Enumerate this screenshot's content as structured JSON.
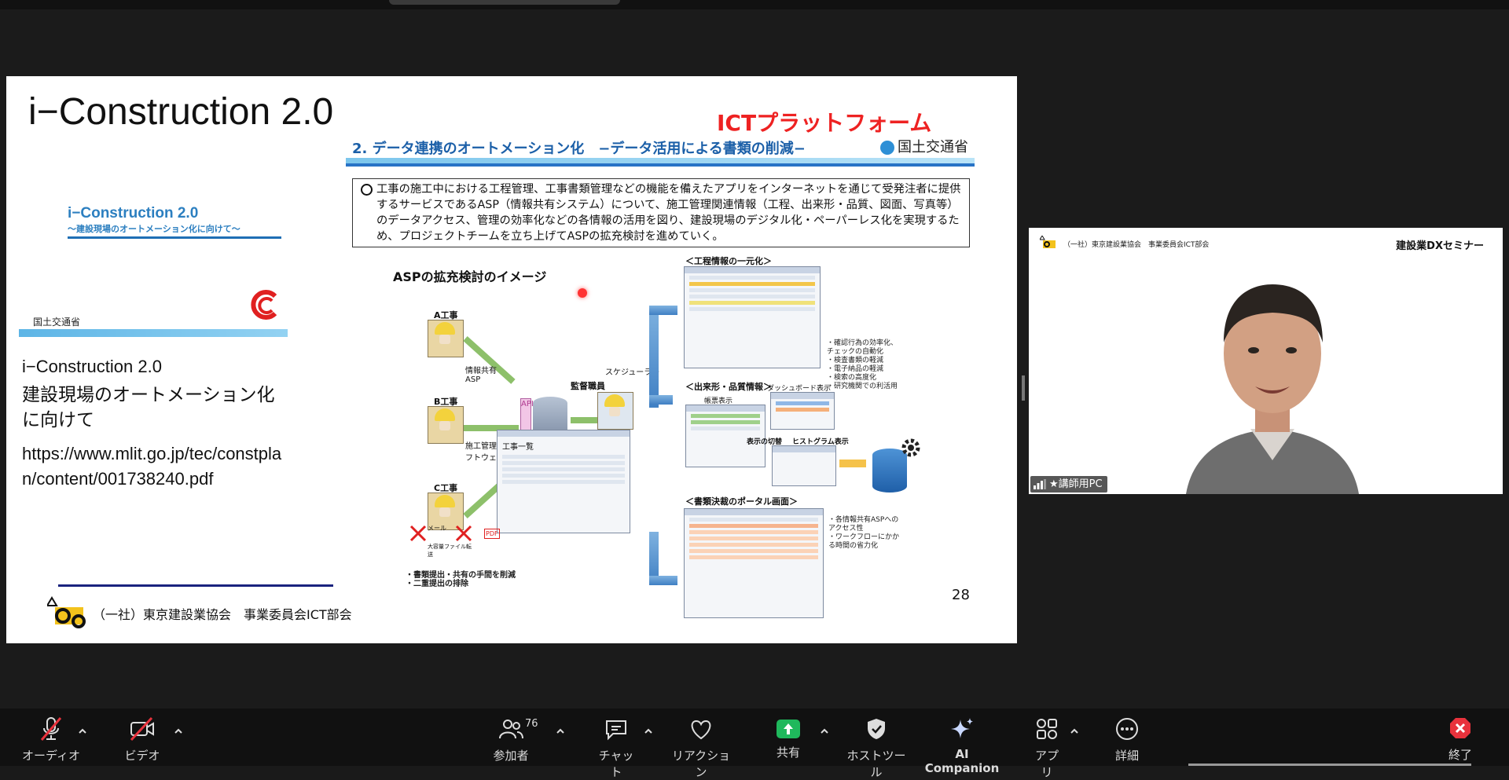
{
  "slide": {
    "title": "i−Construction 2.0",
    "mini_title_line1": "i−Construction 2.0",
    "mini_title_line2": "〜建設現場のオートメーション化に向けて〜",
    "ministry_name": "国土交通省",
    "doc_title": "i−Construction 2.0",
    "doc_subtitle": "建設現場のオートメーション化に向けて",
    "doc_url": "https://www.mlit.go.jp/tec/constplan/content/001738240.pdf",
    "footer_org": "（一社）東京建設業協会　事業委員会ICT部会",
    "page_number": "28"
  },
  "inner_slide": {
    "ict_title": "ICTプラットフォーム",
    "heading": "2. データ連携のオートメーション化　−データ活用による書類の削減−",
    "ministry": "国土交通省",
    "info_text": "工事の施工中における工程管理、工事書類管理などの機能を備えたアプリをインターネットを通じて受発注者に提供するサービスであるASP（情報共有システム）について、施工管理関連情報（工程、出来形・品質、図面、写真等）のデータアクセス、管理の効率化などの各情報の活用を図り、建設現場のデジタル化・ペーパーレス化を実現するため、プロジェクトチームを立ち上げてASPの拡充検討を進めていく。",
    "asp_label": "ASPの拡充検討のイメージ",
    "actor_a": "A工事",
    "actor_b": "B工事",
    "actor_c": "C工事",
    "share_asp": "情報共有ASP",
    "software": "施工管理ソフトウェア",
    "supervisor": "監督職員",
    "scheduler": "スケジューラー",
    "api": "API",
    "process_label": "＜工程情報の一元化＞",
    "quality_label": "＜出来形・品質情報＞",
    "dashboard_label": "ダッシュボード表示",
    "deviation_label": "帳票表示",
    "switch_label": "表示の切替",
    "histogram_label": "ヒストグラム表示",
    "portal_label": "＜書類決裁のポータル画面＞",
    "work_list": "工事一覧",
    "note_right": "・確認行為の効率化、チェックの自動化\n・検査書類の軽減\n・電子納品の軽減\n・検索の高度化\n・研究機関での利活用",
    "note_portal": "・各情報共有ASPへのアクセス性\n・ワークフローにかかる時間の省力化",
    "note_bottom": "・書類提出・共有の手間を削減\n・二重提出の排除",
    "mail": "メール",
    "fax": "大容量ファイル転送",
    "pdf": "PDF"
  },
  "video": {
    "org": "（一社）東京建設業協会　事業委員会ICT部会",
    "title": "建設業DXセミナー",
    "participant_name": "★講師用PC"
  },
  "toolbar": {
    "audio": "オーディオ",
    "video": "ビデオ",
    "participants": "参加者",
    "participants_count": "76",
    "chat": "チャット",
    "reactions": "リアクション",
    "share": "共有",
    "host_tools": "ホストツール",
    "ai_companion": "AI Companion",
    "apps": "アプリ",
    "more": "詳細",
    "end": "終了"
  },
  "colors": {
    "end_red": "#e8323c",
    "share_green": "#1fb85c",
    "slide_heading_blue": "#1b5fa8",
    "ict_red": "#ee2222"
  }
}
